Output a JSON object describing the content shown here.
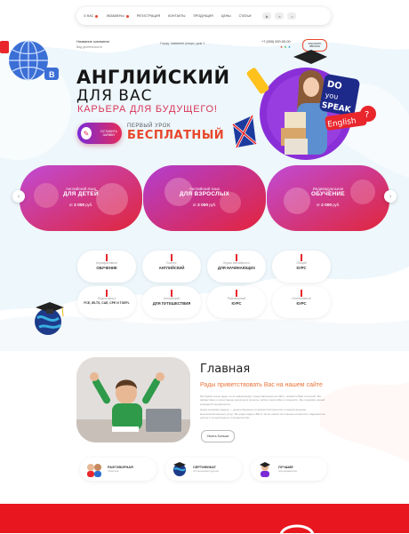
{
  "nav": {
    "items": [
      {
        "label": "О НАС",
        "dot": true
      },
      {
        "label": "ЭКЗАМЕНЫ",
        "dot": true
      },
      {
        "label": "РЕГИСТРАЦИЯ",
        "dot": false
      },
      {
        "label": "КОНТАКТЫ",
        "dot": false
      },
      {
        "label": "ПРОДУКЦИЯ",
        "dot": false
      },
      {
        "label": "ЦЕНЫ",
        "dot": false
      },
      {
        "label": "СТАТЬИ",
        "dot": false
      }
    ],
    "social": [
      "YT",
      "VK",
      "OK"
    ]
  },
  "header": {
    "company": "Название компании",
    "company_sub": "Вид деятельности",
    "address": "Город, название улицы, дом 1",
    "phone": "+7 (000) 000-00-00",
    "callback": "ЗАКАЗАТЬ ЗВОНОК"
  },
  "hero": {
    "title1": "АНГЛИЙСКИЙ",
    "title2": "ДЛЯ ВАС",
    "subtitle": "КАРЬЕРА ДЛЯ БУДУЩЕГО!",
    "cta": "ОСТАВИТЬ ЗАЯВКУ",
    "first_lesson": "ПЕРВЫЙ УРОК",
    "free": "БЕСПЛАТНЫЙ",
    "bubble_text": "DO YOU SPEAK English ?"
  },
  "programs": [
    {
      "pre": "Английский язык",
      "name": "ДЛЯ ДЕТЕЙ",
      "price_from": "от",
      "price": "2 000",
      "currency": "руб."
    },
    {
      "pre": "Английский язык",
      "name": "ДЛЯ ВЗРОСЛЫХ",
      "price_from": "от",
      "price": "2 000",
      "currency": "руб."
    },
    {
      "pre": "Индивидуальное",
      "name": "ОБУЧЕНИЕ",
      "price_from": "от",
      "price": "2 000",
      "currency": "руб."
    }
  ],
  "features": [
    {
      "pre": "Корпоративное",
      "name": "ОБУЧЕНИЕ"
    },
    {
      "pre": "Бизнес",
      "name": "АНГЛИЙСКИЙ"
    },
    {
      "pre": "Курсы английского",
      "name": "ДЛЯ НАЧИНАЮЩИХ"
    },
    {
      "pre": "Общий",
      "name": "КУРС"
    },
    {
      "pre": "Подготовка к",
      "name": "FCE, IELTS, CAE, CPE И TOEFL"
    },
    {
      "pre": "Английский",
      "name": "ДЛЯ ПУТЕШЕСТВИЯ"
    },
    {
      "pre": "Разговорный",
      "name": "КУРС"
    },
    {
      "pre": "Интенсивный",
      "name": "КУРС"
    }
  ],
  "about": {
    "heading": "Главная",
    "subheading": "Рады приветствовать Вас на нашем сайте",
    "p1": "Мы будем очень рады, если информация, представленная на сайте, окажется Вам полезной. Мы эффективно и качественно реализуем проекты любого масштаба и сложности. Мы гордимся нашей командой специалистов.",
    "p2": "Наша основная задача — удовлетворение потребностей клиентов и предоставление высококачественных услуг. Мы рады видеть Вас в числе наших постоянных клиентов и надеемся на долгое и плодотворное сотрудничество.",
    "more": "Узнать больше"
  },
  "benefits": [
    {
      "title": "РАЗГОВОРНАЯ",
      "sub": "практика"
    },
    {
      "title": "СЕРТИФИКАТ",
      "sub": "об окончании курсов"
    },
    {
      "title": "ЛУЧШИЕ",
      "sub": "преподаватели"
    }
  ],
  "colors": {
    "accent": "#e8462c",
    "purple": "#7a2ad7",
    "pink": "#e52b5a",
    "footer": "#e8171f"
  }
}
